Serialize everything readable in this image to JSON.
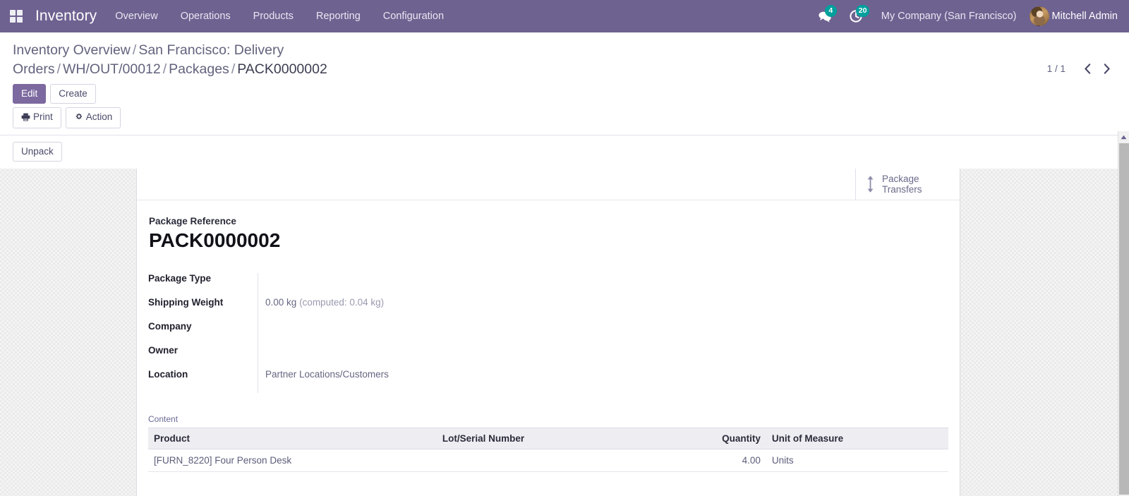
{
  "navbar": {
    "apps_icon": "apps-grid-icon",
    "brand": "Inventory",
    "menu_items": [
      {
        "label": "Overview"
      },
      {
        "label": "Operations"
      },
      {
        "label": "Products"
      },
      {
        "label": "Reporting"
      },
      {
        "label": "Configuration"
      }
    ],
    "messages_icon": "comments-icon",
    "messages_count": "4",
    "activities_icon": "clock-icon",
    "activities_count": "20",
    "company": "My Company (San Francisco)",
    "user_name": "Mitchell Admin",
    "avatar_icon": "user-avatar",
    "background_color": "#6E6291",
    "badge_color": "#00A09D"
  },
  "control_panel": {
    "breadcrumb": [
      {
        "label": "Inventory Overview",
        "active": false
      },
      {
        "label": "San Francisco: Delivery Orders",
        "active": false
      },
      {
        "label": "WH/OUT/00012",
        "active": false
      },
      {
        "label": "Packages",
        "active": false
      },
      {
        "label": "PACK0000002",
        "active": true
      }
    ],
    "breadcrumb_separator": "/",
    "edit_label": "Edit",
    "create_label": "Create",
    "print_label": "Print",
    "print_icon": "printer-icon",
    "action_label": "Action",
    "action_icon": "gear-icon",
    "pager_value": "1 / 1",
    "pager_prev_icon": "chevron-left-icon",
    "pager_next_icon": "chevron-right-icon",
    "statusbar_buttons": [
      {
        "label": "Unpack"
      }
    ],
    "primary_color": "#7C699F"
  },
  "form": {
    "smart_buttons": [
      {
        "label": "Package\nTransfers",
        "icon": "arrows-vertical-icon"
      }
    ],
    "title_label": "Package Reference",
    "title_value": "PACK0000002",
    "fields": [
      {
        "label": "Package Type",
        "value": ""
      },
      {
        "label": "Shipping Weight",
        "value": "0.00 kg",
        "extra": "(computed: 0.04 kg)"
      },
      {
        "label": "Company",
        "value": ""
      },
      {
        "label": "Owner",
        "value": ""
      },
      {
        "label": "Location",
        "value": "Partner Locations/Customers"
      }
    ],
    "content_section": {
      "title": "Content",
      "columns": [
        {
          "label": "Product",
          "align": "left"
        },
        {
          "label": "Lot/Serial Number",
          "align": "left"
        },
        {
          "label": "Quantity",
          "align": "right"
        },
        {
          "label": "Unit of Measure",
          "align": "left"
        }
      ],
      "rows": [
        {
          "product": "[FURN_8220] Four Person Desk",
          "lot_serial": "",
          "quantity": "4.00",
          "uom": "Units"
        }
      ]
    }
  }
}
